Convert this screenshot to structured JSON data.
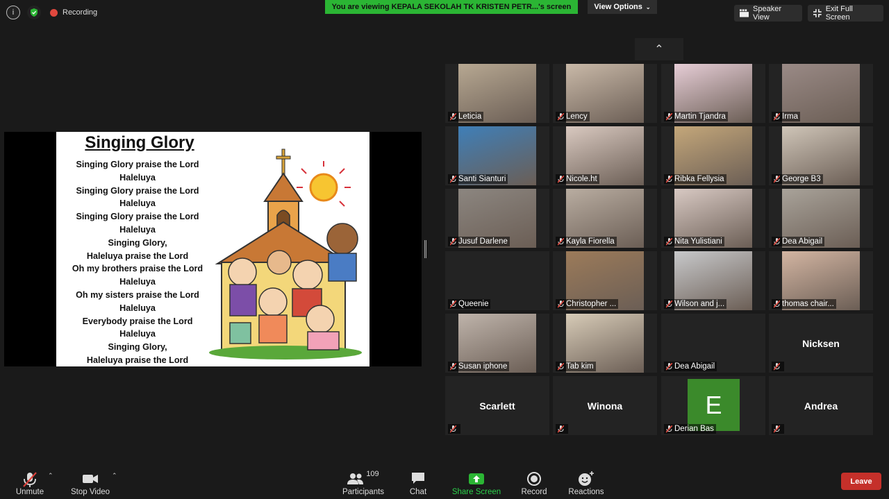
{
  "top": {
    "recording_label": "Recording",
    "viewing_banner": "You are viewing KEPALA SEKOLAH TK KRISTEN PETR...'s screen",
    "view_options": "View Options",
    "speaker_view": "Speaker View",
    "exit_fullscreen": "Exit Full Screen"
  },
  "slide": {
    "title": "Singing Glory",
    "lines": [
      "Singing Glory praise the Lord",
      "Haleluya",
      "Singing Glory praise the Lord",
      "Haleluya",
      "Singing Glory praise the Lord",
      "Haleluya",
      "Singing Glory,",
      "Haleluya praise the Lord",
      "Oh my brothers praise the Lord",
      "Haleluya",
      "Oh my sisters praise the Lord",
      "Haleluya",
      "Everybody praise the Lord",
      "Haleluya",
      "Singing Glory,",
      "Haleluya praise the Lord"
    ]
  },
  "participants": [
    {
      "name": "Leticia",
      "video": true,
      "color": "#b7a892"
    },
    {
      "name": "Lency",
      "video": true,
      "color": "#c9b9a8"
    },
    {
      "name": "Martin Tjandra",
      "video": true,
      "color": "#e6cdd6"
    },
    {
      "name": "Irma",
      "video": true,
      "color": "#9a8a86"
    },
    {
      "name": "Santi Sianturi",
      "video": true,
      "color": "#3f7fb8"
    },
    {
      "name": "Nicole.ht",
      "video": true,
      "color": "#d9c9c0"
    },
    {
      "name": "Ribka Fellysia",
      "video": true,
      "color": "#c4a77a"
    },
    {
      "name": "George B3",
      "video": true,
      "color": "#cfc5b8"
    },
    {
      "name": "Jusuf Darlene",
      "video": true,
      "color": "#8c8680"
    },
    {
      "name": "Kayla Fiorella",
      "video": true,
      "color": "#b9ada1"
    },
    {
      "name": "Nita Yulistiani",
      "video": true,
      "color": "#d8c9c3"
    },
    {
      "name": "Dea Abigail",
      "video": true,
      "color": "#a9a39a"
    },
    {
      "name": "Queenie",
      "video": false,
      "color": "#232323"
    },
    {
      "name": "Christopher ...",
      "video": true,
      "color": "#9c7b5a"
    },
    {
      "name": "Wilson and j...",
      "video": true,
      "color": "#c8c9cb"
    },
    {
      "name": "thomas chair...",
      "video": true,
      "color": "#d3b5a2"
    },
    {
      "name": "Susan iphone",
      "video": true,
      "color": "#bfb4ab"
    },
    {
      "name": "Tab kim",
      "video": true,
      "color": "#d7cbb7"
    },
    {
      "name": "Dea Abigail",
      "video": false,
      "color": "#232323"
    },
    {
      "name": "",
      "big": "Nicksen",
      "video": false,
      "color": "#232323"
    },
    {
      "name": "",
      "big": "Scarlett",
      "video": false,
      "color": "#232323"
    },
    {
      "name": "",
      "big": "Winona",
      "video": false,
      "color": "#232323"
    },
    {
      "name": "Derian Bas",
      "avatar": "E",
      "video": false,
      "color": "#232323"
    },
    {
      "name": "",
      "big": "Andrea",
      "video": false,
      "color": "#232323"
    }
  ],
  "toolbar": {
    "unmute": "Unmute",
    "stop_video": "Stop Video",
    "participants": "Participants",
    "participant_count": "109",
    "chat": "Chat",
    "share_screen": "Share Screen",
    "record": "Record",
    "reactions": "Reactions",
    "leave": "Leave"
  },
  "colors": {
    "share_green": "#2bb534",
    "leave_red": "#c5302a",
    "avatar_green": "#3b8a2b"
  }
}
